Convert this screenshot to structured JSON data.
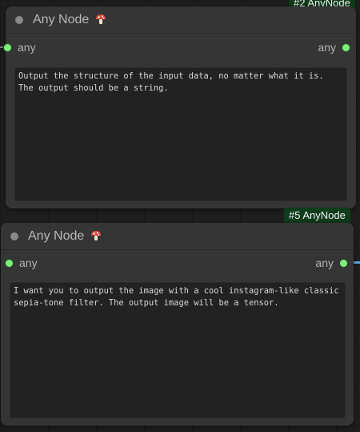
{
  "nodes": [
    {
      "badge": "#2 AnyNode",
      "title": "Any Node",
      "input_label": "any",
      "output_label": "any",
      "prompt": "Output the structure of the input data, no matter what it is. The output should be a string."
    },
    {
      "badge": "#5 AnyNode",
      "title": "Any Node",
      "input_label": "any",
      "output_label": "any",
      "prompt": "I want you to output the image with a cool instagram-like classic sepia-tone filter. The output image will be a tensor."
    }
  ],
  "colors": {
    "slot": "#7cf07a",
    "badge_bg": "#0f3c1b",
    "node_bg": "#353535",
    "link": "#58a6d8"
  },
  "icons": {
    "title_icon": "mushroom-icon",
    "collapse_icon": "collapse-dot-icon"
  }
}
